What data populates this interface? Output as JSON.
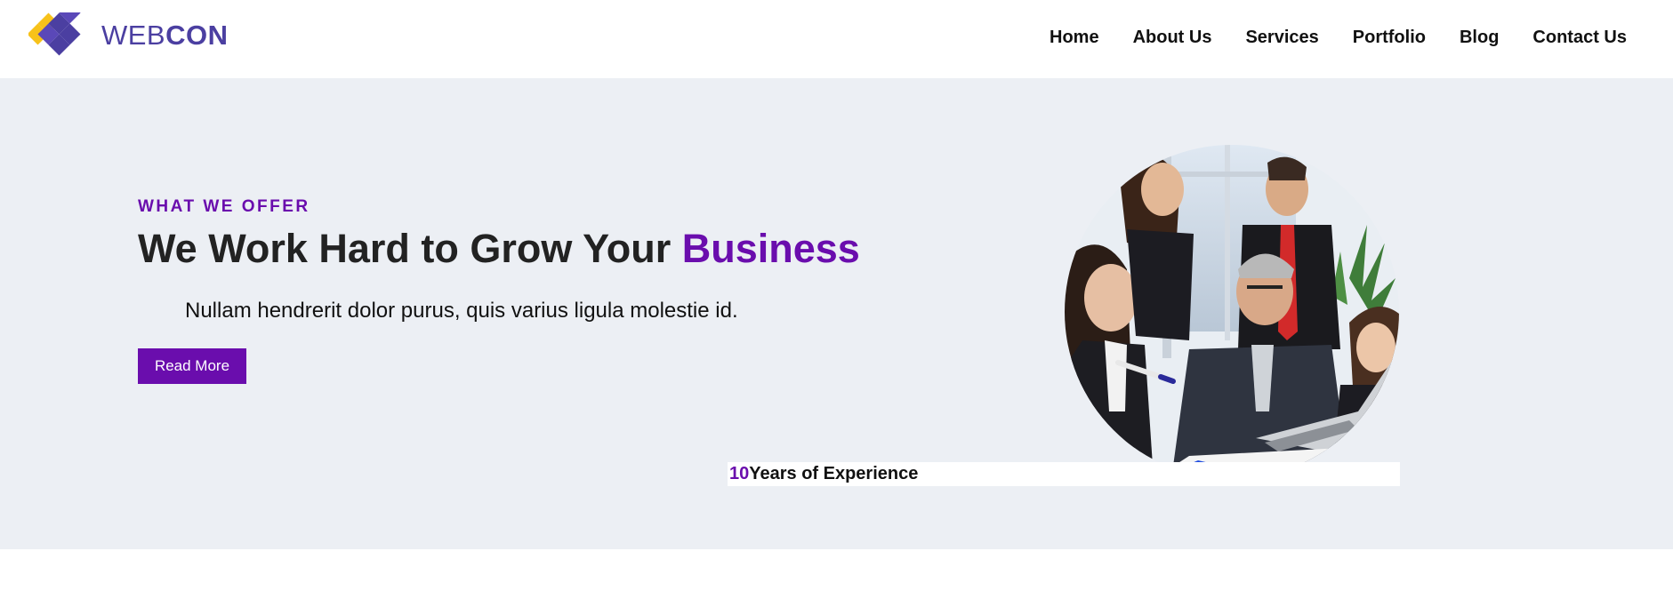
{
  "header": {
    "logo": {
      "text_light": "WEB",
      "text_bold": "CON",
      "icon": "diamond-grid-logo-icon"
    },
    "nav": [
      {
        "label": "Home"
      },
      {
        "label": "About Us"
      },
      {
        "label": "Services"
      },
      {
        "label": "Portfolio"
      },
      {
        "label": "Blog"
      },
      {
        "label": "Contact Us"
      }
    ]
  },
  "hero": {
    "eyebrow": "WHAT WE OFFER",
    "headline_main": "We Work Hard to Grow Your ",
    "headline_accent": "Business",
    "lead": "Nullam hendrerit dolor purus, quis varius ligula molestie id.",
    "button_label": "Read More",
    "photo_alt": "Business team working around a laptop",
    "experience": {
      "number": "10",
      "label": "Years of Experience"
    }
  },
  "colors": {
    "accent": "#6a0dad",
    "logo_purple": "#4b3fa1",
    "logo_yellow": "#f7c21a",
    "hero_bg": "#eceff4"
  }
}
